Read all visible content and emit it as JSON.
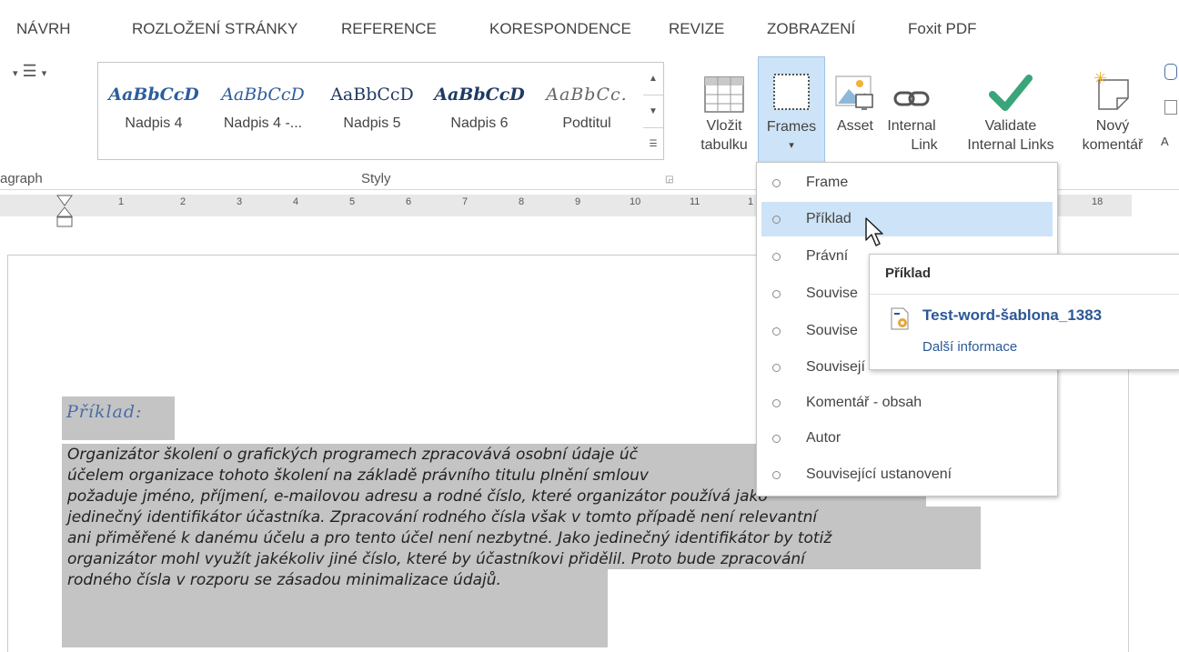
{
  "tabs": [
    "NÁVRH",
    "ROZLOŽENÍ STRÁNKY",
    "REFERENCE",
    "KORESPONDENCE",
    "REVIZE",
    "ZOBRAZENÍ",
    "Foxit PDF"
  ],
  "styles": {
    "items": [
      {
        "sample": "AaBbCcD",
        "name": "Nadpis 4"
      },
      {
        "sample": "AaBbCcD",
        "name": "Nadpis 4 -..."
      },
      {
        "sample": "AaBbCcD",
        "name": "Nadpis 5"
      },
      {
        "sample": "AaBbCcD",
        "name": "Nadpis 6"
      },
      {
        "sample": "AaBbCc.",
        "name": "Podtitul"
      }
    ],
    "group_label": "Styly"
  },
  "paragraph_group_label": "agraph",
  "ribbon_buttons": {
    "table_l1": "Vložit",
    "table_l2": "tabulku",
    "frames": "Frames",
    "frames_arrow": "▾",
    "asset": "Asset",
    "internal_l1": "Internal",
    "internal_l2": "Link",
    "validate_l1": "Validate",
    "validate_l2": "Internal Links",
    "comment_l1": "Nový",
    "comment_l2": "komentář",
    "cut_label": "A"
  },
  "ruler": {
    "numbers": [
      "1",
      "2",
      "3",
      "4",
      "5",
      "6",
      "7",
      "8",
      "9",
      "10",
      "11",
      "1",
      "18"
    ]
  },
  "dropdown": {
    "items": [
      "Frame",
      "Příklad",
      "Právní",
      "Souvise",
      "Souvise",
      "Souvisejí",
      "Komentář - obsah",
      "Autor",
      "Související ustanovení"
    ],
    "hover_index": 1
  },
  "tooltip": {
    "title": "Příklad",
    "link": "Test-word-šablona_1383",
    "more": "Další informace"
  },
  "document": {
    "heading": "Příklad:",
    "lines": [
      "Organizátor školení o grafických programech zpracovává osobní údaje úč",
      "účelem organizace tohoto školení na základě právního titulu plnění smlouv",
      "požaduje jméno, příjmení, e-mailovou adresu a rodné číslo, které organizátor používá jako",
      "jedinečný identifikátor účastníka. Zpracování rodného čísla však v tomto případě není relevantní",
      "ani přiměřené k danému účelu a pro tento účel není nezbytné. Jako jedinečný identifikátor by totiž",
      "organizátor mohl využít jakékoliv jiné číslo, které by účastníkovi přidělil. Proto bude zpracování",
      "rodného čísla v rozporu se zásadou minimalizace údajů."
    ]
  },
  "colors": {
    "accent": "#2b5797",
    "highlight": "#c4c4c4",
    "hover": "#cde3f7",
    "check_green": "#3aa47b"
  }
}
